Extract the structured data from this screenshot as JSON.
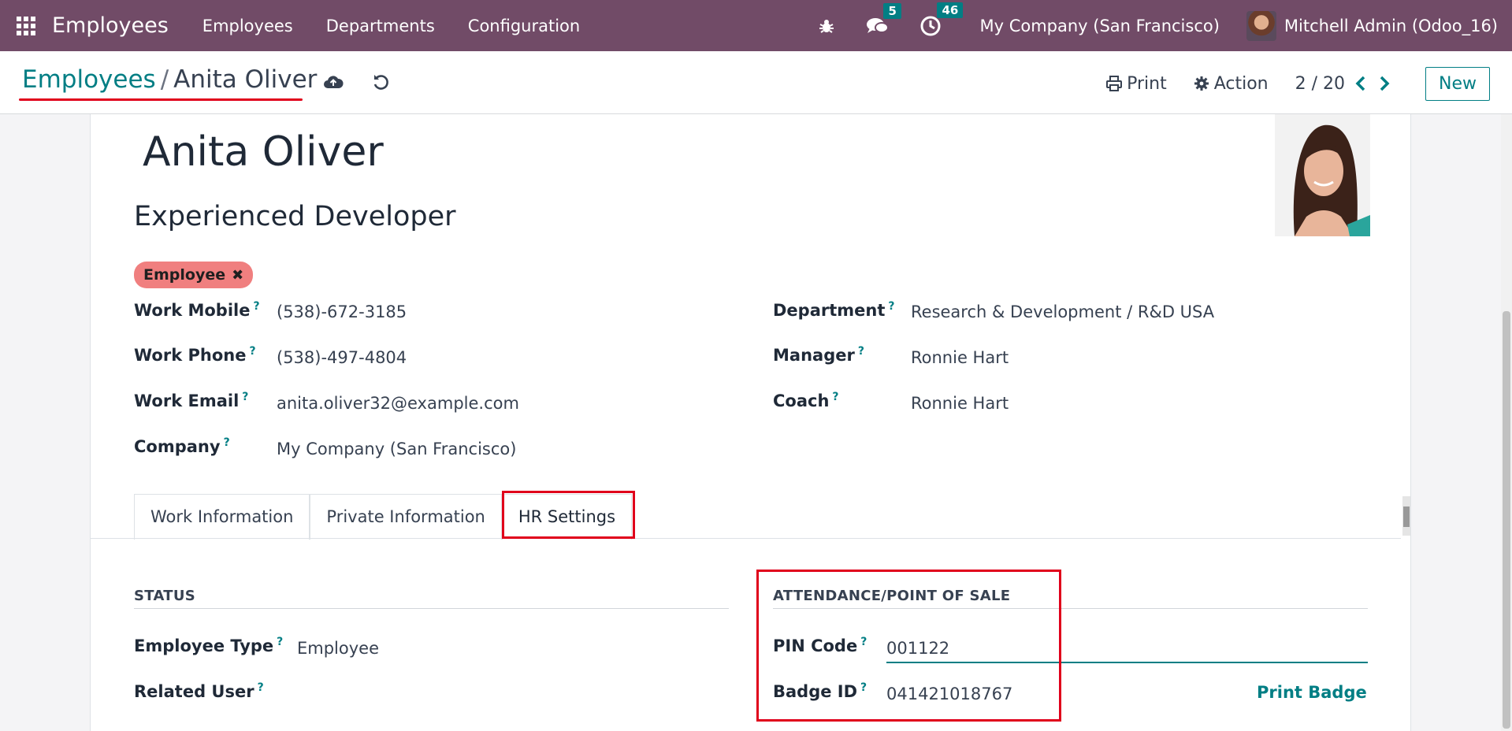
{
  "app": {
    "title": "Employees"
  },
  "nav": {
    "menu": [
      "Employees",
      "Departments",
      "Configuration"
    ],
    "messages_count": "5",
    "activities_count": "46",
    "company": "My Company (San Francisco)",
    "user": "Mitchell Admin (Odoo_16)"
  },
  "breadcrumb": {
    "parent": "Employees",
    "separator": "/",
    "current": "Anita Oliver"
  },
  "control": {
    "print": "Print",
    "action": "Action",
    "pager": "2 / 20",
    "new": "New"
  },
  "employee": {
    "name": "Anita Oliver",
    "job_title": "Experienced Developer",
    "tag": "Employee"
  },
  "fields_left": [
    {
      "label": "Work Mobile",
      "value": "(538)-672-3185"
    },
    {
      "label": "Work Phone",
      "value": "(538)-497-4804"
    },
    {
      "label": "Work Email",
      "value": "anita.oliver32@example.com"
    },
    {
      "label": "Company",
      "value": "My Company (San Francisco)"
    }
  ],
  "fields_right": [
    {
      "label": "Department",
      "value": "Research & Development / R&D USA"
    },
    {
      "label": "Manager",
      "value": "Ronnie Hart"
    },
    {
      "label": "Coach",
      "value": "Ronnie Hart"
    }
  ],
  "help_mark": "?",
  "tabs": [
    "Work Information",
    "Private Information",
    "HR Settings"
  ],
  "status": {
    "title": "STATUS",
    "employee_type_label": "Employee Type",
    "employee_type_value": "Employee",
    "related_user_label": "Related User",
    "related_user_value": ""
  },
  "attendance": {
    "title": "ATTENDANCE/POINT OF SALE",
    "pin_label": "PIN Code",
    "pin_value": "001122",
    "badge_label": "Badge ID",
    "badge_value": "041421018767",
    "print_badge": "Print Badge"
  },
  "colors": {
    "navbar": "#714b67",
    "accent": "#017e84",
    "highlight": "#e0001b",
    "tag": "#f07f7f"
  }
}
